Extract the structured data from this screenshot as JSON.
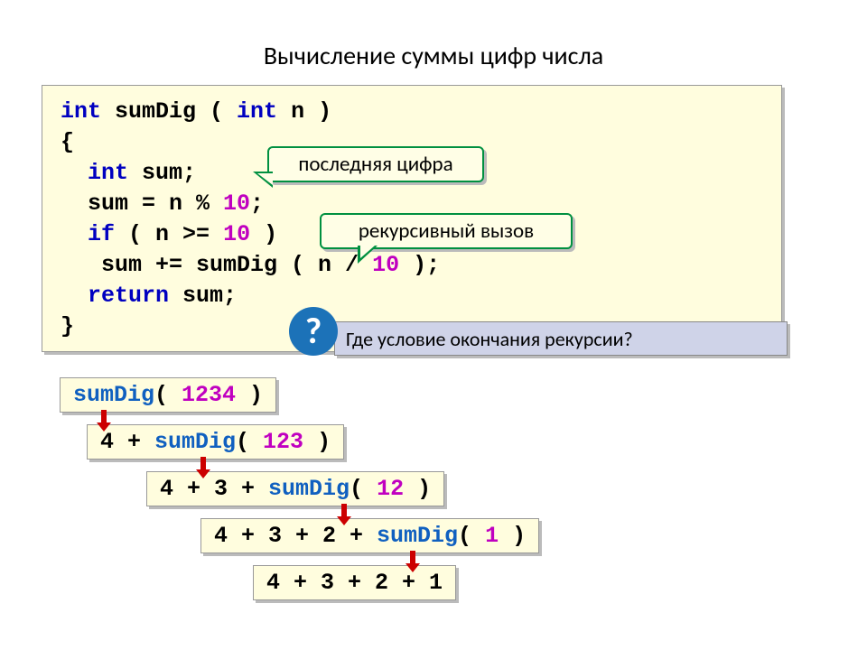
{
  "title": "Вычисление суммы цифр числа",
  "code": {
    "l1a": "int",
    "l1b": " sumDig ( ",
    "l1c": "int",
    "l1d": " n )",
    "l2": "{",
    "l3a": "  ",
    "l3b": "int",
    "l3c": " sum;",
    "l4a": "  sum = n % ",
    "l4b": "10",
    "l4c": ";",
    "l5a": "  ",
    "l5b": "if",
    "l5c": " ( n >= ",
    "l5d": "10",
    "l5e": " )",
    "l6a": "   sum += sumDig ( n / ",
    "l6b": "10",
    "l6c": " );",
    "l7a": "  ",
    "l7b": "return",
    "l7c": " sum;",
    "l8": "}"
  },
  "bubble1": "последняя цифра",
  "bubble2": "рекурсивный вызов",
  "qmark": "?",
  "question": "Где условие окончания рекурсии?",
  "steps": {
    "s1fn": "sumDig",
    "s1a": "( ",
    "s1n": "1234",
    "s1b": " )",
    "s2a": "4 + ",
    "s2fn": "sumDig",
    "s2b": "( ",
    "s2n": "123",
    "s2c": " )",
    "s3a": "4 + 3 + ",
    "s3fn": "sumDig",
    "s3b": "( ",
    "s3n": "12",
    "s3c": " )",
    "s4a": "4 + 3 + 2 + ",
    "s4fn": "sumDig",
    "s4b": "( ",
    "s4n": "1",
    "s4c": " )",
    "s5": "4 + 3 + 2 + 1"
  }
}
